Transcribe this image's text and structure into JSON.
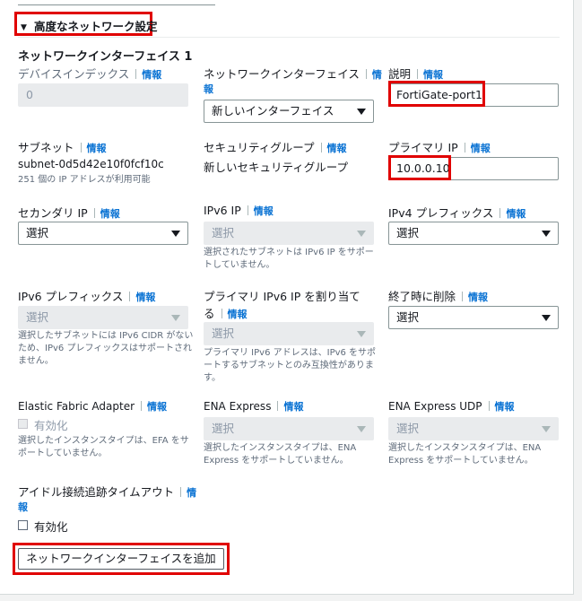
{
  "section": {
    "title": "高度なネットワーク設定"
  },
  "heading": "ネットワークインターフェイス 1",
  "info_label": "情報",
  "fields": {
    "device_index": {
      "label": "デバイスインデックス",
      "value": "0"
    },
    "network_interface": {
      "label_line1": "ネットワークインターフェイス",
      "value": "新しいインターフェイス"
    },
    "description": {
      "label": "説明",
      "value": "FortiGate-port1"
    },
    "subnet": {
      "label": "サブネット",
      "value": "subnet-0d5d42e10f0fcf10c",
      "hint": "251 個の IP アドレスが利用可能"
    },
    "security_group": {
      "label": "セキュリティグループ",
      "value": "新しいセキュリティグループ"
    },
    "primary_ip": {
      "label": "プライマリ IP",
      "value": "10.0.0.10"
    },
    "secondary_ip": {
      "label": "セカンダリ IP",
      "value": "選択"
    },
    "ipv6_ip": {
      "label": "IPv6 IP",
      "value": "選択",
      "hint1": "選択されたサブネットは IPv6 IP をサポー",
      "hint2": "トしていません。"
    },
    "ipv4_prefix": {
      "label": "IPv4 プレフィックス",
      "value": "選択"
    },
    "ipv6_prefix": {
      "label": "IPv6 プレフィックス",
      "value": "選択",
      "hint1": "選択したサブネットには IPv6 CIDR がない",
      "hint2": "ため、IPv6 プレフィックスはサポートされ",
      "hint3": "ません。"
    },
    "assign_primary_ipv6": {
      "label_line1": "プライマリ IPv6 IP を割り当て",
      "label_line2": "る",
      "value": "選択",
      "hint1": "プライマリ IPv6 アドレスは、IPv6 をサポ",
      "hint2": "ートするサブネットとのみ互換性がありま",
      "hint3": "す。"
    },
    "delete_on_termination": {
      "label": "終了時に削除",
      "value": "選択"
    },
    "efa": {
      "label": "Elastic Fabric Adapter",
      "checkbox": "有効化",
      "hint1": "選択したインスタンスタイプは、EFA をサ",
      "hint2": "ポートしていません。"
    },
    "ena_express": {
      "label": "ENA Express",
      "value": "選択",
      "hint1": "選択したインスタンスタイプは、ENA",
      "hint2": "Express をサポートしていません。"
    },
    "ena_express_udp": {
      "label": "ENA Express UDP",
      "value": "選択",
      "hint1": "選択したインスタンスタイプは、ENA",
      "hint2": "Express をサポートしていません。"
    },
    "idle_timeout": {
      "label": "アイドル接続追跡タイムアウト",
      "checkbox": "有効化"
    }
  },
  "add_button": "ネットワークインターフェイスを追加",
  "colors": {
    "highlight": "#e00000",
    "link": "#0972d3"
  }
}
